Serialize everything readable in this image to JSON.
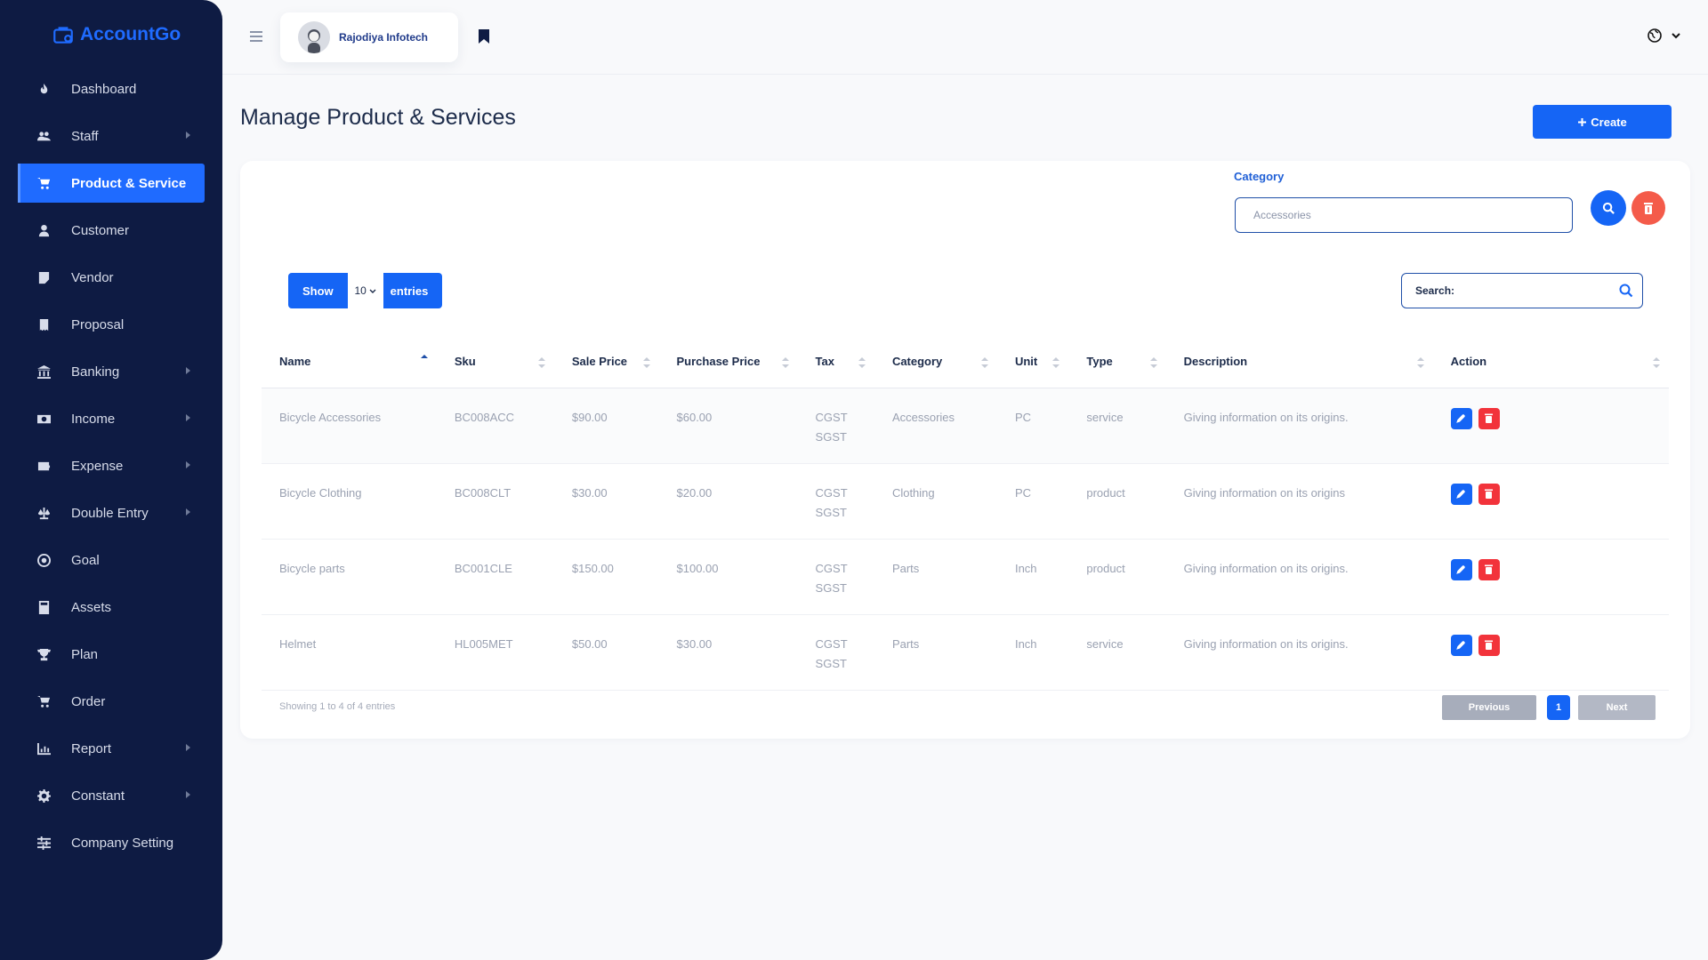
{
  "app": {
    "logo_text": "AccountGo"
  },
  "sidebar": {
    "items": [
      {
        "label": "Dashboard",
        "icon": "fire-icon",
        "has_children": false,
        "active": false
      },
      {
        "label": "Staff",
        "icon": "users-icon",
        "has_children": true,
        "active": false
      },
      {
        "label": "Product & Service",
        "icon": "cart-icon",
        "has_children": false,
        "active": true
      },
      {
        "label": "Customer",
        "icon": "user-tie-icon",
        "has_children": false,
        "active": false
      },
      {
        "label": "Vendor",
        "icon": "note-icon",
        "has_children": false,
        "active": false
      },
      {
        "label": "Proposal",
        "icon": "receipt-icon",
        "has_children": false,
        "active": false
      },
      {
        "label": "Banking",
        "icon": "bank-icon",
        "has_children": true,
        "active": false
      },
      {
        "label": "Income",
        "icon": "money-icon",
        "has_children": true,
        "active": false
      },
      {
        "label": "Expense",
        "icon": "wallet-icon",
        "has_children": true,
        "active": false
      },
      {
        "label": "Double Entry",
        "icon": "scale-icon",
        "has_children": true,
        "active": false
      },
      {
        "label": "Goal",
        "icon": "target-icon",
        "has_children": false,
        "active": false
      },
      {
        "label": "Assets",
        "icon": "calculator-icon",
        "has_children": false,
        "active": false
      },
      {
        "label": "Plan",
        "icon": "trophy-icon",
        "has_children": false,
        "active": false
      },
      {
        "label": "Order",
        "icon": "cart-plus-icon",
        "has_children": false,
        "active": false
      },
      {
        "label": "Report",
        "icon": "chart-icon",
        "has_children": true,
        "active": false
      },
      {
        "label": "Constant",
        "icon": "gear-icon",
        "has_children": true,
        "active": false
      },
      {
        "label": "Company Setting",
        "icon": "sliders-icon",
        "has_children": false,
        "active": false
      }
    ]
  },
  "topbar": {
    "user_name": "Rajodiya Infotech"
  },
  "page": {
    "title": "Manage Product & Services",
    "create_label": "Create"
  },
  "filter": {
    "label": "Category",
    "value": "Accessories"
  },
  "entries": {
    "show_label": "Show",
    "value": "10",
    "entries_label": "entries"
  },
  "search": {
    "placeholder": "Search:"
  },
  "table": {
    "columns": [
      "Name",
      "Sku",
      "Sale Price",
      "Purchase Price",
      "Tax",
      "Category",
      "Unit",
      "Type",
      "Description",
      "Action"
    ],
    "rows": [
      {
        "name": "Bicycle Accessories",
        "sku": "BC008ACC",
        "sale": "$90.00",
        "purchase": "$60.00",
        "tax1": "CGST",
        "tax2": "SGST",
        "category": "Accessories",
        "unit": "PC",
        "type": "service",
        "description": "Giving information on its origins."
      },
      {
        "name": "Bicycle Clothing",
        "sku": "BC008CLT",
        "sale": "$30.00",
        "purchase": "$20.00",
        "tax1": "CGST",
        "tax2": "SGST",
        "category": "Clothing",
        "unit": "PC",
        "type": "product",
        "description": "Giving information on its origins"
      },
      {
        "name": "Bicycle parts",
        "sku": "BC001CLE",
        "sale": "$150.00",
        "purchase": "$100.00",
        "tax1": "CGST",
        "tax2": "SGST",
        "category": "Parts",
        "unit": "Inch",
        "type": "product",
        "description": "Giving information on its origins."
      },
      {
        "name": "Helmet",
        "sku": "HL005MET",
        "sale": "$50.00",
        "purchase": "$30.00",
        "tax1": "CGST",
        "tax2": "SGST",
        "category": "Parts",
        "unit": "Inch",
        "type": "service",
        "description": "Giving information on its origins."
      }
    ]
  },
  "footer": {
    "showing": "Showing 1 to 4 of 4 entries",
    "prev": "Previous",
    "page": "1",
    "next": "Next"
  },
  "colors": {
    "primary": "#1565f5",
    "sidebar_bg": "#0e1b43",
    "danger": "#f2333b",
    "reset": "#f45b4a"
  }
}
